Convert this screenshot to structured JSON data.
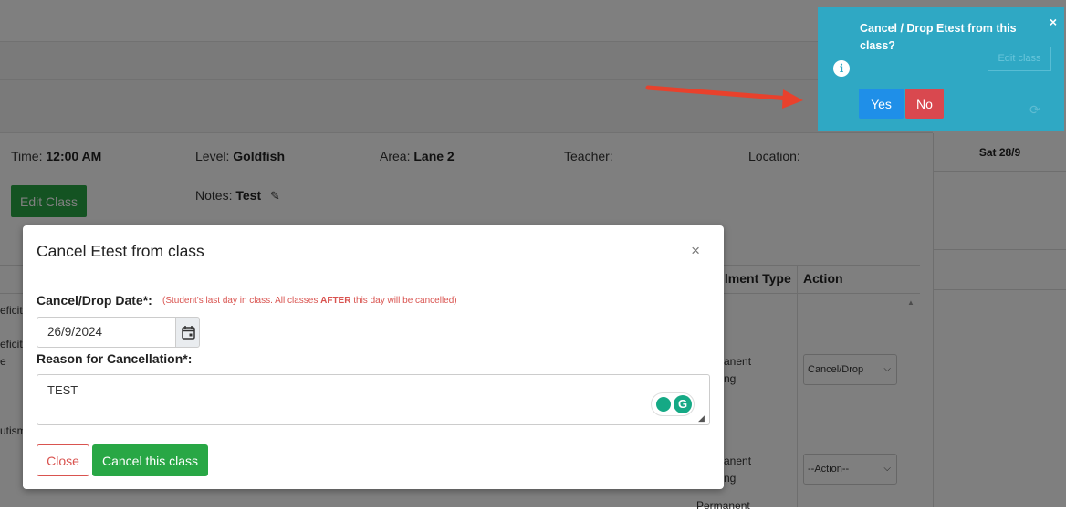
{
  "class_info": {
    "time_label": "Time:",
    "time_value": "12:00 AM",
    "level_label": "Level:",
    "level_value": "Goldfish",
    "area_label": "Area:",
    "area_value": "Lane 2",
    "teacher_label": "Teacher:",
    "location_label": "Location:",
    "edit_class_label": "Edit Class",
    "notes_label": "Notes:",
    "notes_value": "Test"
  },
  "calendar": {
    "day_header": "Sat 28/9"
  },
  "table": {
    "headers": {
      "enrollment_type": "llment Type",
      "action": "Action"
    },
    "row_fragments": [
      "eficit",
      "eficit",
      "e",
      "utism"
    ],
    "enrollment_fragments": [
      "anent",
      "ng",
      "anent",
      "ng",
      "Permanent"
    ],
    "action_selects": [
      "Cancel/Drop",
      "--Action--"
    ]
  },
  "popover": {
    "title": "Cancel / Drop Etest from this class?",
    "close": "×",
    "info_icon": "i",
    "yes": "Yes",
    "no": "No",
    "behind_button": "Edit class"
  },
  "modal": {
    "title": "Cancel Etest from class",
    "close_x": "×",
    "date_label": "Cancel/Drop Date*:",
    "hint_before": "(Student's last day in class. All classes ",
    "hint_bold": "AFTER",
    "hint_after": " this day will be cancelled)",
    "date_value": "26/9/2024",
    "reason_label": "Reason for Cancellation*:",
    "reason_value": "TEST",
    "close_button": "Close",
    "cancel_button": "Cancel this class"
  },
  "colors": {
    "popover_bg": "#2fa8c4",
    "yes_button": "#1f8fe8",
    "no_button": "#d9484f",
    "success_green": "#28a745",
    "danger_red": "#d9534f",
    "arrow_red": "#e8412c"
  },
  "icons": {
    "pencil": "pencil-icon",
    "calendar": "calendar-icon",
    "info": "info-icon",
    "refresh": "refresh-icon",
    "grammarly": "grammarly-icon"
  }
}
